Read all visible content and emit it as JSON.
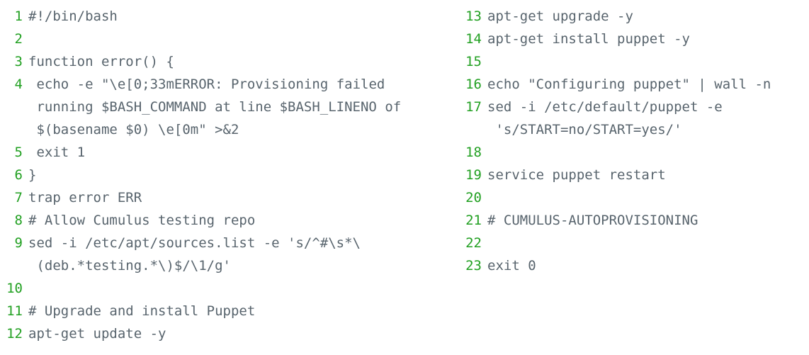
{
  "listing": {
    "language": "bash",
    "colors": {
      "background": "#ffffff",
      "line_number": "#22a022",
      "code_text": "#58646d"
    },
    "columns": [
      {
        "name": "left-column",
        "lines": [
          {
            "number": "1",
            "code": "#!/bin/bash"
          },
          {
            "number": "2",
            "code": ""
          },
          {
            "number": "3",
            "code": "function error() {"
          },
          {
            "number": "4",
            "code": " echo -e \"\\e[0;33mERROR: Provisioning failed running $BASH_COMMAND at line $BASH_LINENO of $(basename $0) \\e[0m\" >&2"
          },
          {
            "number": "5",
            "code": " exit 1"
          },
          {
            "number": "6",
            "code": "}"
          },
          {
            "number": "7",
            "code": "trap error ERR"
          },
          {
            "number": "8",
            "code": "# Allow Cumulus testing repo"
          },
          {
            "number": "9",
            "code": "sed -i /etc/apt/sources.list -e 's/^#\\s*\\(deb.*testing.*\\)$/\\1/g'"
          },
          {
            "number": "10",
            "code": ""
          },
          {
            "number": "11",
            "code": "# Upgrade and install Puppet"
          },
          {
            "number": "12",
            "code": "apt-get update -y"
          }
        ]
      },
      {
        "name": "right-column",
        "lines": [
          {
            "number": "13",
            "code": "apt-get upgrade -y"
          },
          {
            "number": "14",
            "code": "apt-get install puppet -y"
          },
          {
            "number": "15",
            "code": ""
          },
          {
            "number": "16",
            "code": "echo \"Configuring puppet\" | wall -n"
          },
          {
            "number": "17",
            "code": "sed -i /etc/default/puppet -e 's/START=no/START=yes/'"
          },
          {
            "number": "18",
            "code": ""
          },
          {
            "number": "19",
            "code": "service puppet restart"
          },
          {
            "number": "20",
            "code": ""
          },
          {
            "number": "21",
            "code": "# CUMULUS-AUTOPROVISIONING"
          },
          {
            "number": "22",
            "code": ""
          },
          {
            "number": "23",
            "code": "exit 0"
          }
        ]
      }
    ]
  }
}
